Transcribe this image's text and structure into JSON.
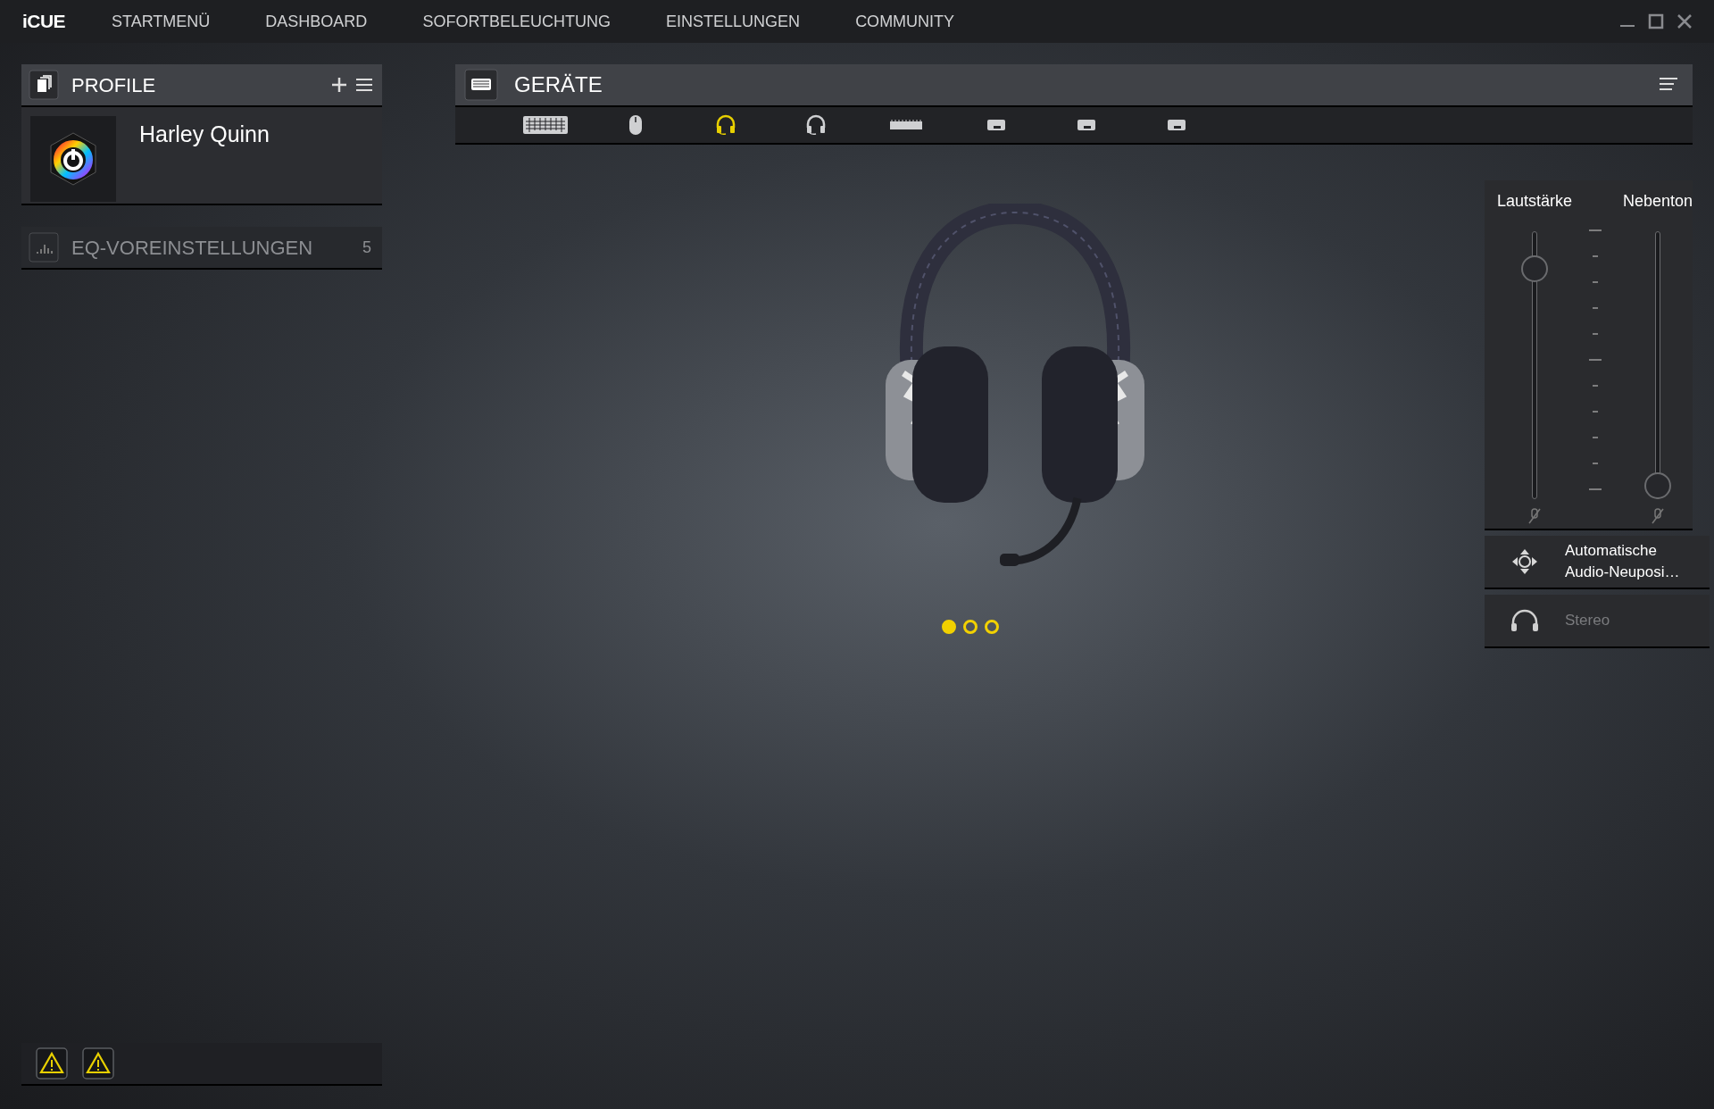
{
  "app": {
    "logo": "iCUE"
  },
  "nav": [
    {
      "label": "STARTMENÜ"
    },
    {
      "label": "DASHBOARD"
    },
    {
      "label": "SOFORTBELEUCHTUNG"
    },
    {
      "label": "EINSTELLUNGEN"
    },
    {
      "label": "COMMUNITY"
    }
  ],
  "profiles": {
    "title": "PROFILE",
    "items": [
      {
        "name": "Harley Quinn"
      }
    ]
  },
  "eq_presets": {
    "title": "EQ-VOREINSTELLUNGEN",
    "count": "5"
  },
  "warnings": [
    {
      "kind": "warning"
    },
    {
      "kind": "warning"
    }
  ],
  "devices": {
    "title": "GERÄTE",
    "tabs": [
      {
        "kind": "keyboard",
        "selected": false
      },
      {
        "kind": "mouse",
        "selected": false
      },
      {
        "kind": "headset",
        "selected": true
      },
      {
        "kind": "headset",
        "selected": false
      },
      {
        "kind": "memory",
        "selected": false
      },
      {
        "kind": "module",
        "selected": false
      },
      {
        "kind": "module",
        "selected": false
      },
      {
        "kind": "module",
        "selected": false
      }
    ],
    "pages": [
      {
        "selected": true
      },
      {
        "selected": false
      },
      {
        "selected": false
      }
    ]
  },
  "audio": {
    "sliders": [
      {
        "label": "Lautstärke",
        "level": 0.9
      },
      {
        "label": "Nebenton",
        "level": 0
      }
    ],
    "options": [
      {
        "kind": "reposition",
        "label": "Automatische Audio-Neuposi…",
        "enabled": true
      },
      {
        "kind": "stereo",
        "label": "Stereo",
        "enabled": false
      }
    ]
  }
}
